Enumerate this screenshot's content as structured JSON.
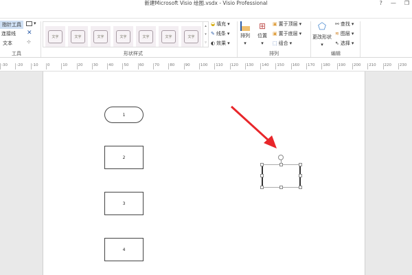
{
  "window": {
    "title": "新建Microsoft Visio 绘图.vsdx - Visio Professional",
    "help": "?",
    "minimize": "—",
    "restore": "❐"
  },
  "ribbon": {
    "tools": {
      "pointer": "指针工具",
      "connector": "连接线",
      "text": "文本",
      "label": "工具"
    },
    "shape_styles": {
      "samples": [
        "文字",
        "文字",
        "文字",
        "文字",
        "文字",
        "文字",
        "文字"
      ],
      "fill": "填充",
      "line": "线条",
      "effects": "效果",
      "label": "形状样式"
    },
    "arrange": {
      "align": "排列",
      "position": "位置",
      "bring_front": "置于顶层",
      "send_back": "置于底层",
      "group": "组合",
      "label": "排列"
    },
    "editing": {
      "change_shape": "更改形状",
      "find": "查找",
      "layers": "图层",
      "select": "选择",
      "label": "编辑"
    }
  },
  "ruler": {
    "ticks": [
      "-30",
      "-20",
      "-10",
      "0",
      "10",
      "20",
      "30",
      "40",
      "50",
      "60",
      "70",
      "80",
      "90",
      "100",
      "110",
      "120",
      "130",
      "140",
      "150",
      "160",
      "170",
      "180",
      "190",
      "200",
      "210",
      "220",
      "230"
    ]
  },
  "diagram": {
    "shapes": [
      "1",
      "2",
      "3",
      "4"
    ]
  },
  "colors": {
    "arrow": "#e8262a",
    "selected_tool": "#cfe0f4"
  }
}
